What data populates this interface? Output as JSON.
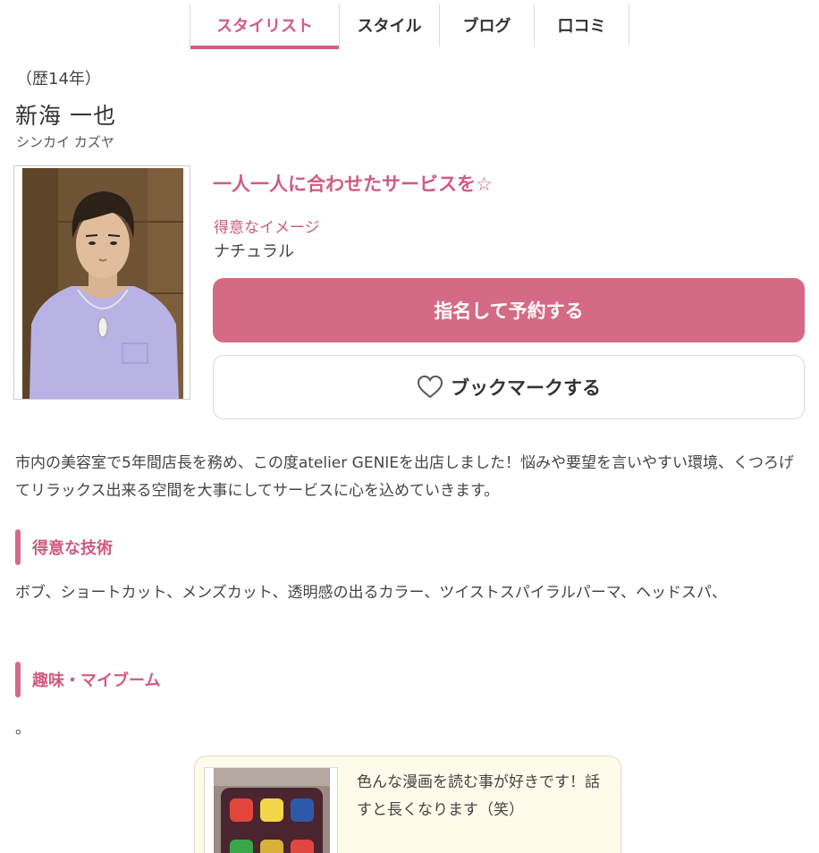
{
  "tabs": [
    {
      "label": "スタイリスト",
      "active": true
    },
    {
      "label": "スタイル",
      "active": false
    },
    {
      "label": "ブログ",
      "active": false
    },
    {
      "label": "口コミ",
      "active": false
    }
  ],
  "stylist": {
    "experience": "（歴14年）",
    "name": "新海 一也",
    "kana": "シンカイ カズヤ",
    "catchphrase": "一人一人に合わせたサービスを☆",
    "image_label": "得意なイメージ",
    "image_value": "ナチュラル"
  },
  "buttons": {
    "reserve": "指名して予約する",
    "bookmark": "ブックマークする"
  },
  "intro": "市内の美容室で5年間店長を務め、この度atelier GENIEを出店しました！悩みや要望を言いやすい環境、くつろげてリラックス出来る空間を大事にしてサービスに心を込めていきます。",
  "skills": {
    "heading": "得意な技術",
    "text": "ボブ、ショートカット、メンズカット、透明感の出るカラー、ツイストスパイラルパーマ、ヘッドスパ、"
  },
  "hobby": {
    "heading": "趣味・マイブーム",
    "text": "。",
    "card_caption": "色んな漫画を読む事が好きです！話すと長くなります（笑）"
  },
  "colors": {
    "accent": "#cf5c7e",
    "button": "#d56a85",
    "card_bg": "#fffbea"
  }
}
